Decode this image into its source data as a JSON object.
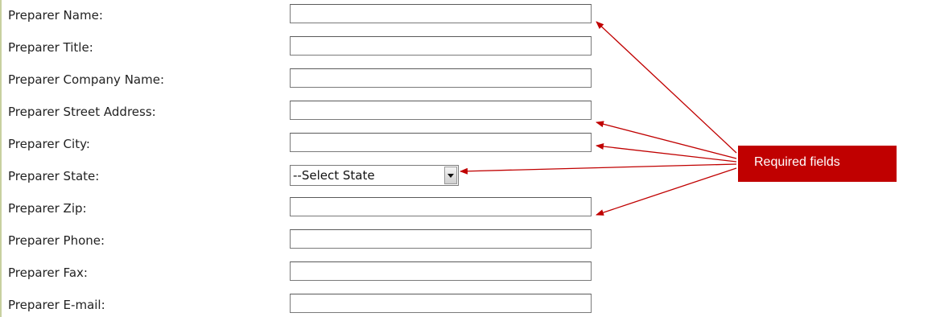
{
  "form": {
    "fields": [
      {
        "label": "Preparer Name:",
        "value": ""
      },
      {
        "label": "Preparer Title:",
        "value": ""
      },
      {
        "label": "Preparer Company Name:",
        "value": ""
      },
      {
        "label": "Preparer Street Address:",
        "value": ""
      },
      {
        "label": "Preparer City:",
        "value": ""
      },
      {
        "label": "Preparer State:",
        "selected": "--Select State"
      },
      {
        "label": "Preparer Zip:",
        "value": ""
      },
      {
        "label": "Preparer Phone:",
        "value": ""
      },
      {
        "label": "Preparer Fax:",
        "value": ""
      },
      {
        "label": "Preparer E-mail:",
        "value": ""
      }
    ]
  },
  "annotation": {
    "text": "Required fields",
    "color": "#c00000"
  }
}
